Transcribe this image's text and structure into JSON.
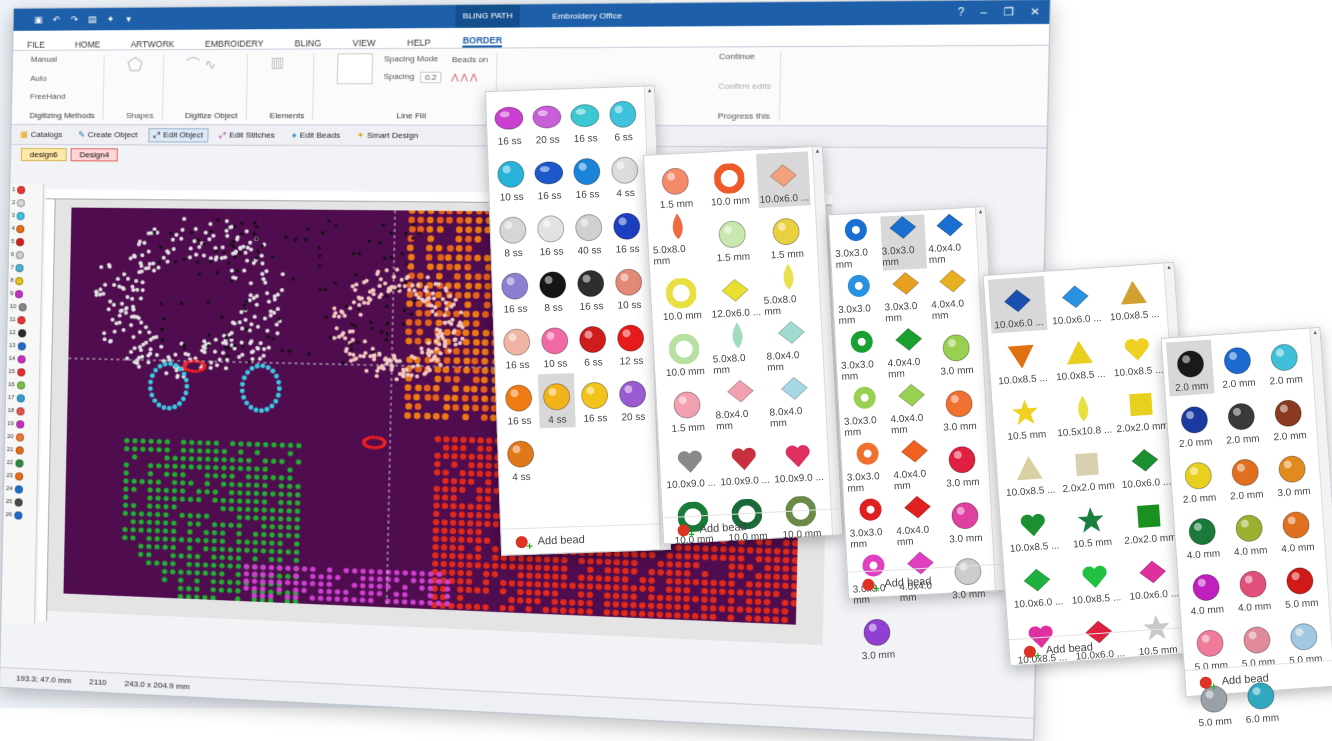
{
  "app": {
    "title": "Embroidery Office",
    "context_tab": "BLING PATH",
    "tabs": [
      "FILE",
      "HOME",
      "ARTWORK",
      "EMBROIDERY",
      "BLING",
      "VIEW",
      "HELP",
      "BORDER"
    ],
    "ribbon": {
      "digitizing": {
        "items": [
          "Manual",
          "Auto",
          "FreeHand"
        ],
        "shapes": "Shapes",
        "label": "Digitizing Methods"
      },
      "digitize_object": "Digitize Object",
      "elements": "Elements",
      "spacing_mode": "Spacing Mode",
      "spacing": "Spacing",
      "spacing_value": "0.2",
      "beads_on": "Beads on",
      "line_fill": "Line Fill",
      "right": {
        "continue": "Continue",
        "confirm": "Confirm edits",
        "progress": "Progress this"
      }
    },
    "toolbar": [
      "Catalogs",
      "Create Object",
      "Edit Object",
      "Edit Stitches",
      "Edit Beads",
      "Smart Design"
    ],
    "doc_tabs": [
      "design6",
      "Design4"
    ],
    "palette": [
      "1",
      "2",
      "3",
      "4",
      "5",
      "6",
      "7",
      "8",
      "9",
      "10",
      "11",
      "12",
      "13",
      "14",
      "15",
      "16",
      "17",
      "18",
      "19",
      "20",
      "21",
      "22",
      "23",
      "24",
      "25",
      "26"
    ],
    "palette_colors": [
      "#e33",
      "#d7d7d7",
      "#3bc7de",
      "#e96e14",
      "#d42020",
      "#cfcfcf",
      "#46b6da",
      "#e9c21a",
      "#c531c6",
      "#8a8a8a",
      "#e33",
      "#2b2b2b",
      "#1c6fd0",
      "#c531c6",
      "#e62f2f",
      "#7ac142",
      "#2f9ed7",
      "#e95050",
      "#c531c6",
      "#f07a2e",
      "#e96e14",
      "#2b8d3b",
      "#e96e14",
      "#1c6fd0",
      "#4a4a4a",
      "#1c6fd0"
    ],
    "status": {
      "coords": "193.3; 47.0 mm",
      "count": "2110",
      "size": "243.0 x 204.9 mm"
    }
  },
  "panels": [
    {
      "cols": 4,
      "items": [
        {
          "label": "16 ss",
          "color": "#c93fd0",
          "shape": "oval"
        },
        {
          "label": "20 ss",
          "color": "#c95fd8",
          "shape": "oval"
        },
        {
          "label": "16 ss",
          "color": "#3cc8d0",
          "shape": "oval"
        },
        {
          "label": "6 ss",
          "color": "#3dc4dc",
          "shape": "circle"
        },
        {
          "label": "10 ss",
          "color": "#27b3da",
          "shape": "circle"
        },
        {
          "label": "16 ss",
          "color": "#1e57c8",
          "shape": "oval"
        },
        {
          "label": "16 ss",
          "color": "#1a84d8",
          "shape": "circle"
        },
        {
          "label": "4 ss",
          "color": "#dcdcdc",
          "shape": "circle"
        },
        {
          "label": "8 ss",
          "color": "#d6d6d6",
          "shape": "circle"
        },
        {
          "label": "16 ss",
          "color": "#e2e2e2",
          "shape": "circle"
        },
        {
          "label": "40 ss",
          "color": "#d0d0d0",
          "shape": "circle"
        },
        {
          "label": "16 ss",
          "color": "#1b3fbf",
          "shape": "circle"
        },
        {
          "label": "16 ss",
          "color": "#8a7fd0",
          "shape": "circle"
        },
        {
          "label": "8 ss",
          "color": "#151515",
          "shape": "circle"
        },
        {
          "label": "16 ss",
          "color": "#2e2e2e",
          "shape": "circle"
        },
        {
          "label": "10 ss",
          "color": "#e28a76",
          "shape": "circle"
        },
        {
          "label": "16 ss",
          "color": "#f0b4a4",
          "shape": "circle"
        },
        {
          "label": "10 ss",
          "color": "#f06aa6",
          "shape": "circle"
        },
        {
          "label": "6 ss",
          "color": "#cf1c1c",
          "shape": "circle"
        },
        {
          "label": "12 ss",
          "color": "#e61a1a",
          "shape": "circle"
        },
        {
          "label": "16 ss",
          "color": "#ef7b12",
          "shape": "circle"
        },
        {
          "label": "4 ss",
          "color": "#f2b21a",
          "shape": "circle",
          "selected": true
        },
        {
          "label": "16 ss",
          "color": "#f2c41a",
          "shape": "circle"
        },
        {
          "label": "20 ss",
          "color": "#9a5ad0",
          "shape": "circle"
        },
        {
          "label": "4 ss",
          "color": "#e0781a",
          "shape": "circle"
        }
      ],
      "add": "Add bead"
    },
    {
      "cols": 3,
      "items": [
        {
          "label": "1.5 mm",
          "color": "#f48a6a",
          "shape": "circle"
        },
        {
          "label": "10.0 mm",
          "color": "#ef5a2a",
          "shape": "ring"
        },
        {
          "label": "10.0x6.0 ...",
          "color": "#f2a27a",
          "shape": "diamond",
          "selected": true
        },
        {
          "label": "5.0x8.0 mm",
          "color": "#f06a40",
          "shape": "drop"
        },
        {
          "label": "1.5 mm",
          "color": "#c8e8b0",
          "shape": "circle"
        },
        {
          "label": "1.5 mm",
          "color": "#e8d040",
          "shape": "circle"
        },
        {
          "label": "10.0 mm",
          "color": "#e8e040",
          "shape": "ring"
        },
        {
          "label": "12.0x6.0 ...",
          "color": "#e8e030",
          "shape": "diamond"
        },
        {
          "label": "5.0x8.0 mm",
          "color": "#e8e050",
          "shape": "drop"
        },
        {
          "label": "10.0 mm",
          "color": "#b8e0a0",
          "shape": "ring"
        },
        {
          "label": "5.0x8.0 mm",
          "color": "#a0dcc0",
          "shape": "drop"
        },
        {
          "label": "8.0x4.0 mm",
          "color": "#a0dcd0",
          "shape": "diamond"
        },
        {
          "label": "1.5 mm",
          "color": "#f0a0b0",
          "shape": "circle"
        },
        {
          "label": "8.0x4.0 mm",
          "color": "#f0a0b0",
          "shape": "diamond"
        },
        {
          "label": "8.0x4.0 mm",
          "color": "#a8d8e8",
          "shape": "diamond"
        },
        {
          "label": "10.0x9.0 ...",
          "color": "#8a8a8a",
          "shape": "heart"
        },
        {
          "label": "10.0x9.0 ...",
          "color": "#c83040",
          "shape": "heart"
        },
        {
          "label": "10.0x9.0 ...",
          "color": "#e03060",
          "shape": "heart"
        },
        {
          "label": "10.0 mm",
          "color": "#1a7a3a",
          "shape": "ring"
        },
        {
          "label": "10.0 mm",
          "color": "#1a6a3a",
          "shape": "ring"
        },
        {
          "label": "10.0 mm",
          "color": "#6a8a4a",
          "shape": "ring"
        }
      ],
      "add": "Add bead"
    },
    {
      "cols": 3,
      "items": [
        {
          "label": "3.0x3.0 mm",
          "color": "#1a70d0",
          "shape": "flower"
        },
        {
          "label": "3.0x3.0 mm",
          "color": "#1a70d0",
          "shape": "diamond",
          "selected": true
        },
        {
          "label": "4.0x4.0 mm",
          "color": "#1a70d0",
          "shape": "diamond"
        },
        {
          "label": "3.0x3.0 mm",
          "color": "#2a90e0",
          "shape": "flower"
        },
        {
          "label": "3.0x3.0 mm",
          "color": "#e8a020",
          "shape": "diamond"
        },
        {
          "label": "4.0x4.0 mm",
          "color": "#e8b020",
          "shape": "diamond"
        },
        {
          "label": "3.0x3.0 mm",
          "color": "#1aa030",
          "shape": "flower"
        },
        {
          "label": "4.0x4.0 mm",
          "color": "#1aa030",
          "shape": "diamond"
        },
        {
          "label": "3.0 mm",
          "color": "#9ad050",
          "shape": "circle"
        },
        {
          "label": "3.0x3.0 mm",
          "color": "#9ad050",
          "shape": "flower"
        },
        {
          "label": "4.0x4.0 mm",
          "color": "#9ad050",
          "shape": "diamond"
        },
        {
          "label": "3.0 mm",
          "color": "#f07030",
          "shape": "circle"
        },
        {
          "label": "3.0x3.0 mm",
          "color": "#f07030",
          "shape": "flower"
        },
        {
          "label": "4.0x4.0 mm",
          "color": "#f06020",
          "shape": "diamond"
        },
        {
          "label": "3.0 mm",
          "color": "#e02040",
          "shape": "circle"
        },
        {
          "label": "3.0x3.0 mm",
          "color": "#e02020",
          "shape": "flower"
        },
        {
          "label": "4.0x4.0 mm",
          "color": "#e02020",
          "shape": "diamond"
        },
        {
          "label": "3.0 mm",
          "color": "#e040a0",
          "shape": "circle"
        },
        {
          "label": "3.0x3.0 mm",
          "color": "#e040c0",
          "shape": "flower"
        },
        {
          "label": "4.0x4.0 mm",
          "color": "#e040c0",
          "shape": "diamond"
        },
        {
          "label": "3.0 mm",
          "color": "#cccccc",
          "shape": "circle"
        },
        {
          "label": "3.0 mm",
          "color": "#9040d0",
          "shape": "circle"
        }
      ],
      "add": "Add bead"
    },
    {
      "cols": 3,
      "items": [
        {
          "label": "10.0x6.0 ...",
          "color": "#1a50b0",
          "shape": "diamond",
          "selected": true
        },
        {
          "label": "10.0x6.0 ...",
          "color": "#2a90e0",
          "shape": "diamond"
        },
        {
          "label": "10.0x8.5 ...",
          "color": "#d0a030",
          "shape": "triangle"
        },
        {
          "label": "10.0x8.5 ...",
          "color": "#e07010",
          "shape": "triangle-down"
        },
        {
          "label": "10.0x8.5 ...",
          "color": "#e8d020",
          "shape": "triangle"
        },
        {
          "label": "10.0x8.5 ...",
          "color": "#f0d020",
          "shape": "heart"
        },
        {
          "label": "10.5 mm",
          "color": "#f0d020",
          "shape": "star"
        },
        {
          "label": "10.5x10.8 ...",
          "color": "#e8e040",
          "shape": "drop"
        },
        {
          "label": "2.0x2.0 mm",
          "color": "#e8d020",
          "shape": "square"
        },
        {
          "label": "10.0x8.5 ...",
          "color": "#d8d0a0",
          "shape": "triangle"
        },
        {
          "label": "2.0x2.0 mm",
          "color": "#d8d0b0",
          "shape": "square"
        },
        {
          "label": "10.0x6.0 ...",
          "color": "#1a9030",
          "shape": "diamond"
        },
        {
          "label": "10.0x8.5 ...",
          "color": "#1a9030",
          "shape": "heart"
        },
        {
          "label": "10.5 mm",
          "color": "#1a8040",
          "shape": "star"
        },
        {
          "label": "2.0x2.0 mm",
          "color": "#1a9020",
          "shape": "square"
        },
        {
          "label": "10.0x6.0 ...",
          "color": "#20b040",
          "shape": "diamond"
        },
        {
          "label": "10.0x8.5 ...",
          "color": "#20c040",
          "shape": "heart"
        },
        {
          "label": "10.0x6.0 ...",
          "color": "#e030a0",
          "shape": "diamond"
        },
        {
          "label": "10.0x8.5 ...",
          "color": "#e030a0",
          "shape": "heart"
        },
        {
          "label": "10.0x6.0 ...",
          "color": "#e02040",
          "shape": "diamond"
        },
        {
          "label": "10.5 mm",
          "color": "#c8c8c8",
          "shape": "star"
        }
      ],
      "add": "Add bead"
    },
    {
      "cols": 3,
      "items": [
        {
          "label": "2.0 mm",
          "color": "#1a1a1a",
          "shape": "circle",
          "selected": true
        },
        {
          "label": "2.0 mm",
          "color": "#1a6ad0",
          "shape": "circle"
        },
        {
          "label": "2.0 mm",
          "color": "#40c0d8",
          "shape": "circle"
        },
        {
          "label": "2.0 mm",
          "color": "#1a3aa0",
          "shape": "circle"
        },
        {
          "label": "2.0 mm",
          "color": "#3a3a3a",
          "shape": "circle"
        },
        {
          "label": "2.0 mm",
          "color": "#8a3a20",
          "shape": "circle"
        },
        {
          "label": "2.0 mm",
          "color": "#e8d020",
          "shape": "circle"
        },
        {
          "label": "2.0 mm",
          "color": "#e07020",
          "shape": "circle"
        },
        {
          "label": "3.0 mm",
          "color": "#e08a20",
          "shape": "circle"
        },
        {
          "label": "4.0 mm",
          "color": "#1a7a3a",
          "shape": "circle"
        },
        {
          "label": "4.0 mm",
          "color": "#9ab030",
          "shape": "circle"
        },
        {
          "label": "4.0 mm",
          "color": "#e07020",
          "shape": "circle"
        },
        {
          "label": "4.0 mm",
          "color": "#c020c0",
          "shape": "circle"
        },
        {
          "label": "4.0 mm",
          "color": "#e0507a",
          "shape": "circle"
        },
        {
          "label": "5.0 mm",
          "color": "#d01a1a",
          "shape": "circle"
        },
        {
          "label": "5.0 mm",
          "color": "#f07a9a",
          "shape": "circle"
        },
        {
          "label": "5.0 mm",
          "color": "#e08a9a",
          "shape": "circle"
        },
        {
          "label": "5.0 mm",
          "color": "#a0c8e0",
          "shape": "circle"
        },
        {
          "label": "5.0 mm",
          "color": "#9aa0a8",
          "shape": "circle"
        },
        {
          "label": "6.0 mm",
          "color": "#30a8c0",
          "shape": "circle"
        }
      ],
      "add": "Add bead"
    }
  ]
}
